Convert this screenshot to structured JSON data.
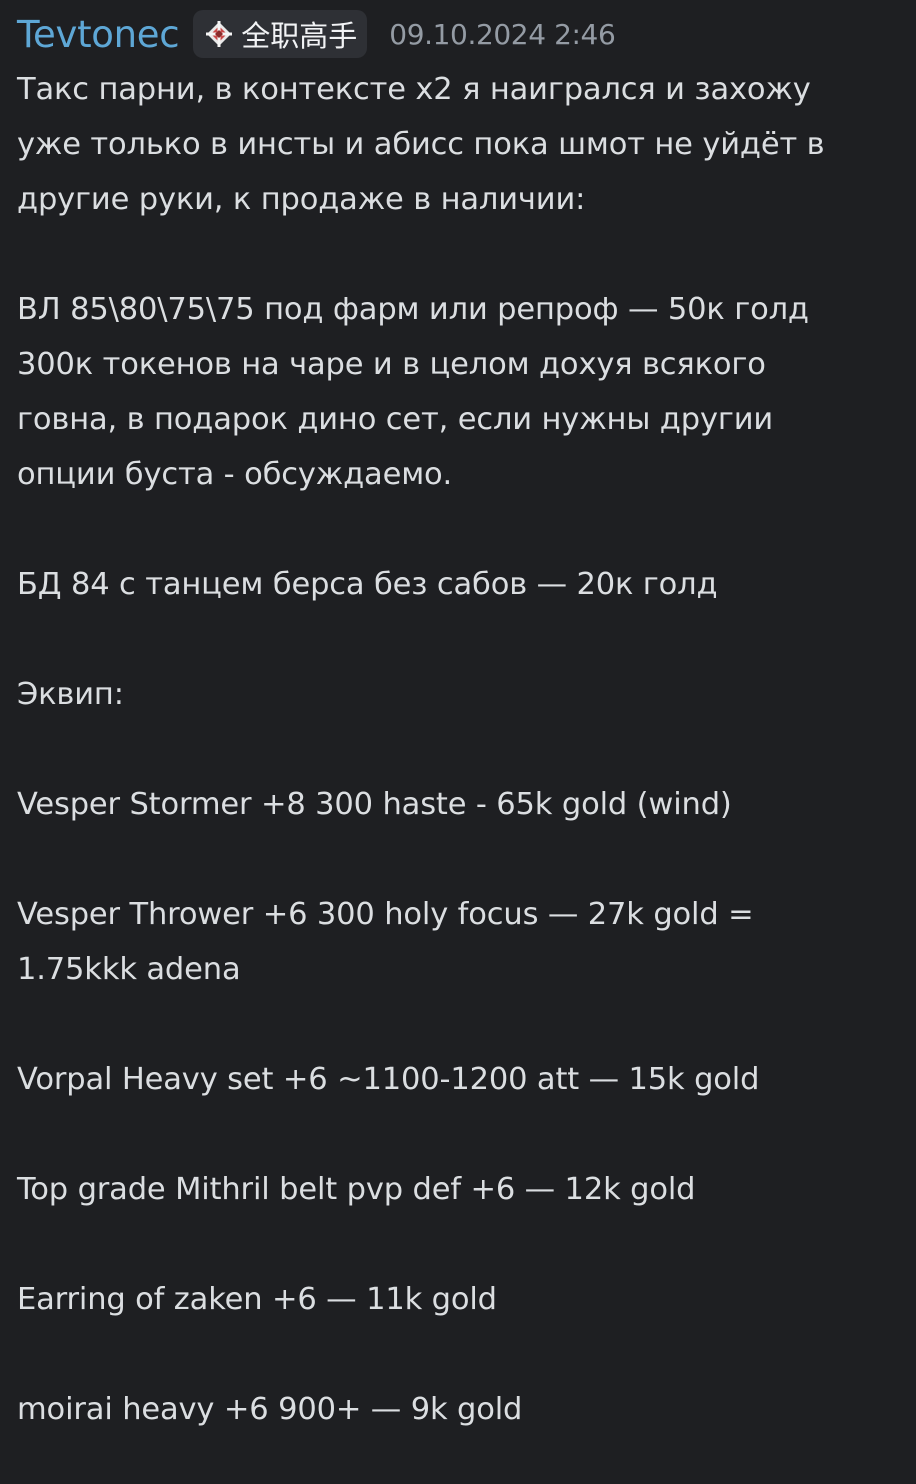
{
  "message": {
    "username": "Tevtonec",
    "tag_text": "全职高手",
    "tag_icon": "diamond-crosshair-icon",
    "timestamp": "09.10.2024 2:46",
    "username_color": "#5ea7d6",
    "paragraphs": [
      [
        "Такс парни, в контексте х2  я наигрался и захожу",
        "уже только в инсты и абисс пока шмот не уйдёт в",
        "другие руки, к продаже в наличии:"
      ],
      [
        "ВЛ 85\\80\\75\\75 под фарм или репроф — 50к голд",
        "300к токенов на чаре и в целом дохуя всякого",
        "говна, в подарок дино сет, если нужны другии",
        "опции буста - обсуждаемо."
      ],
      [
        "БД 84 с танцем берса без сабов — 20к голд"
      ],
      [
        "Эквип:"
      ],
      [
        "Vesper Stormer +8 300 haste - 65k gold (wind)"
      ],
      [
        "Vesper Thrower +6 300 holy focus — 27k  gold =",
        "1.75kkk adena"
      ],
      [
        "Vorpal Heavy set +6 ~1100-1200 att — 15k gold"
      ],
      [
        "Top grade Mithril belt pvp def +6 — 12k gold"
      ],
      [
        "Earring of zaken +6 — 11k gold"
      ],
      [
        "moirai heavy +6 900+ — 9k gold"
      ]
    ]
  }
}
